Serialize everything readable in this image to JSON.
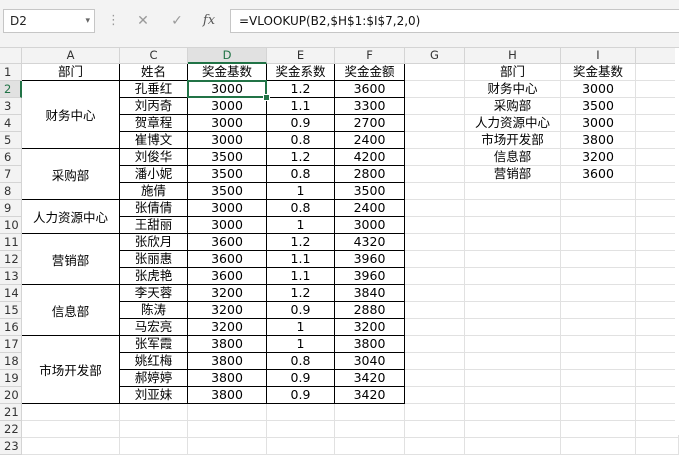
{
  "name_box": "D2",
  "formula": "=VLOOKUP(B2,$H$1:$I$7,2,0)",
  "icons": {
    "cancel": "✕",
    "confirm": "✓",
    "fx": "fx",
    "dropdown": "▾",
    "grip": "⋮"
  },
  "accent_color": "#217346",
  "columns": [
    "A",
    "C",
    "D",
    "E",
    "F",
    "G",
    "H",
    "I"
  ],
  "selected_column": "D",
  "rows": [
    "1",
    "2",
    "3",
    "4",
    "5",
    "6",
    "7",
    "8",
    "9",
    "10",
    "11",
    "12",
    "13",
    "14",
    "15",
    "16",
    "17",
    "18",
    "19",
    "20",
    "21",
    "22",
    "23"
  ],
  "selected_row": "2",
  "headers": [
    "部门",
    "姓名",
    "奖金基数",
    "奖金系数",
    "奖金金额"
  ],
  "departments": [
    "财务中心",
    "采购部",
    "人力资源中心",
    "营销部",
    "信息部",
    "市场开发部"
  ],
  "records": [
    [
      "孔垂红",
      "3000",
      "1.2",
      "3600"
    ],
    [
      "刘丙奇",
      "3000",
      "1.1",
      "3300"
    ],
    [
      "贺章程",
      "3000",
      "0.9",
      "2700"
    ],
    [
      "崔博文",
      "3000",
      "0.8",
      "2400"
    ],
    [
      "刘俊华",
      "3500",
      "1.2",
      "4200"
    ],
    [
      "潘小妮",
      "3500",
      "0.8",
      "2800"
    ],
    [
      "施倩",
      "3500",
      "1",
      "3500"
    ],
    [
      "张倩倩",
      "3000",
      "0.8",
      "2400"
    ],
    [
      "王甜丽",
      "3000",
      "1",
      "3000"
    ],
    [
      "张欣月",
      "3600",
      "1.2",
      "4320"
    ],
    [
      "张丽惠",
      "3600",
      "1.1",
      "3960"
    ],
    [
      "张虎艳",
      "3600",
      "1.1",
      "3960"
    ],
    [
      "李天蓉",
      "3200",
      "1.2",
      "3840"
    ],
    [
      "陈涛",
      "3200",
      "0.9",
      "2880"
    ],
    [
      "马宏亮",
      "3200",
      "1",
      "3200"
    ],
    [
      "张军霞",
      "3800",
      "1",
      "3800"
    ],
    [
      "姚红梅",
      "3800",
      "0.8",
      "3040"
    ],
    [
      "郝婷婷",
      "3800",
      "0.9",
      "3420"
    ],
    [
      "刘亚妹",
      "3800",
      "0.9",
      "3420"
    ]
  ],
  "lookup_headers": [
    "部门",
    "奖金基数"
  ],
  "lookup": [
    [
      "财务中心",
      "3000"
    ],
    [
      "采购部",
      "3500"
    ],
    [
      "人力资源中心",
      "3000"
    ],
    [
      "市场开发部",
      "3800"
    ],
    [
      "信息部",
      "3200"
    ],
    [
      "营销部",
      "3600"
    ]
  ]
}
